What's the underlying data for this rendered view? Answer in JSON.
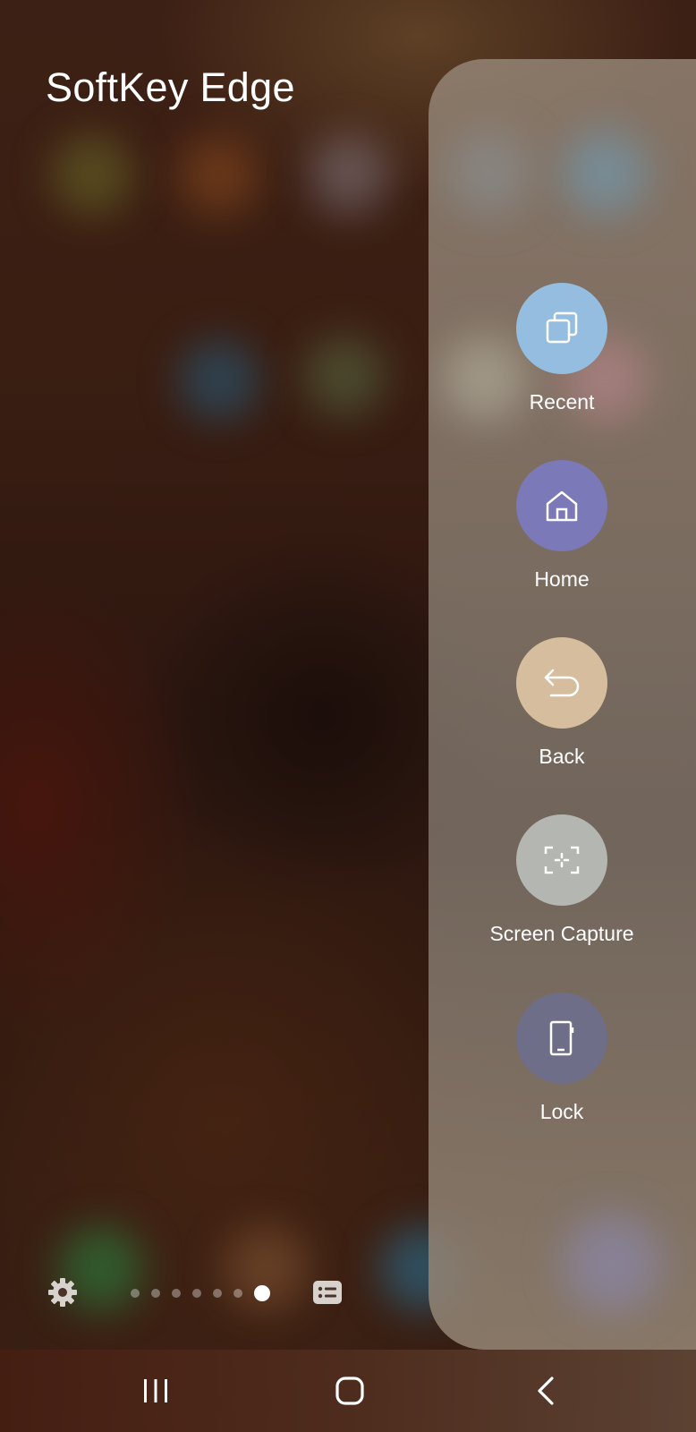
{
  "header": {
    "title": "SoftKey Edge"
  },
  "edge_panel": {
    "keys": [
      {
        "label": "Recent",
        "icon": "recent-apps-icon",
        "color": "#94bde0"
      },
      {
        "label": "Home",
        "icon": "home-icon",
        "color": "#7b79b8"
      },
      {
        "label": "Back",
        "icon": "back-arrow-icon",
        "color": "#d5bd9e"
      },
      {
        "label": "Screen Capture",
        "icon": "screen-capture-icon",
        "color": "#b4b6b1"
      },
      {
        "label": "Lock",
        "icon": "phone-lock-icon",
        "color": "#6e6e88"
      }
    ]
  },
  "panel_controls": {
    "settings_icon": "gear-icon",
    "list_icon": "list-icon",
    "page_count": 7,
    "active_page": 7
  },
  "nav_bar": {
    "recents_icon": "recents-nav-icon",
    "home_icon": "home-nav-icon",
    "back_icon": "back-nav-icon"
  }
}
